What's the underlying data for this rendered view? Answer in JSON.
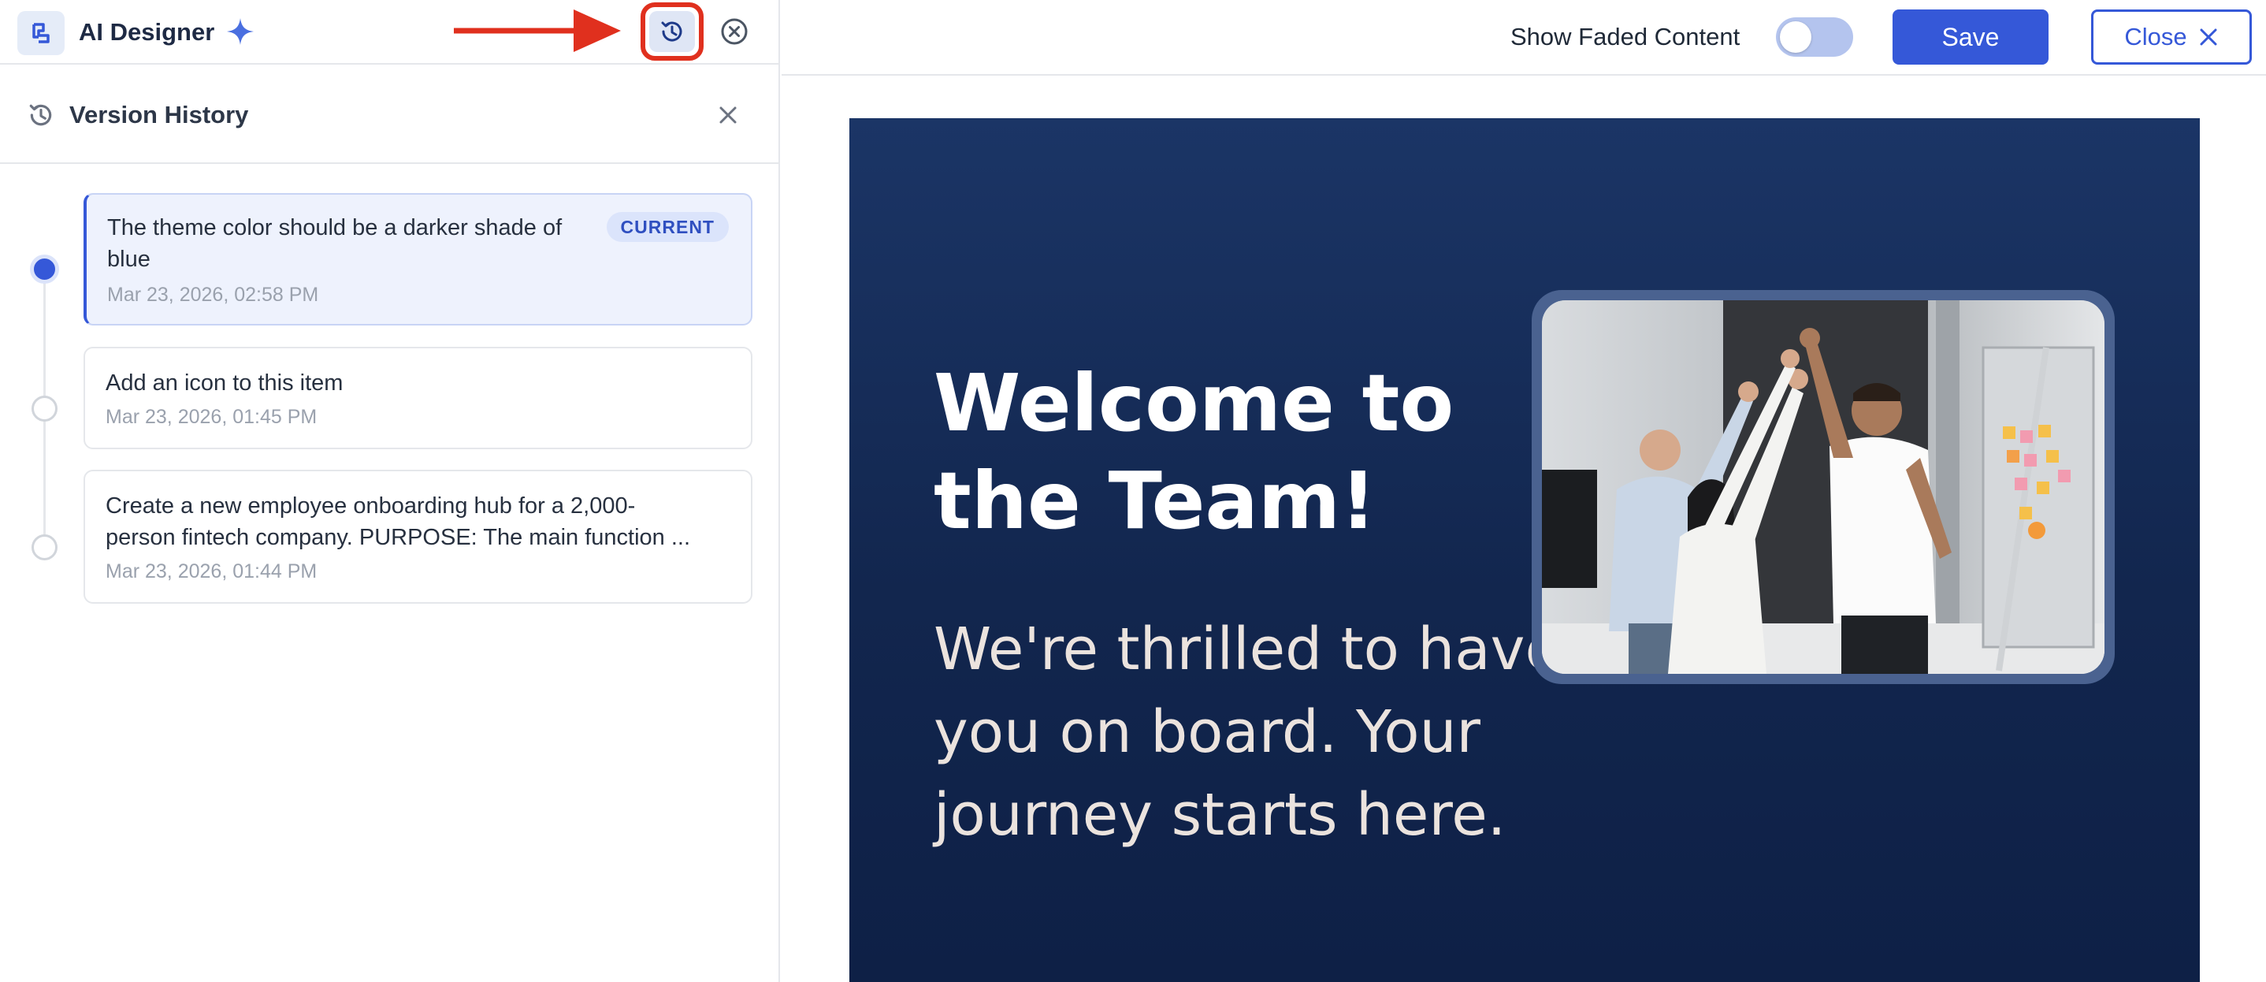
{
  "header": {
    "app_title": "AI Designer"
  },
  "version_history": {
    "title": "Version History",
    "versions": [
      {
        "text_line1": "The theme color should be a darker shade of",
        "text_line2": "blue",
        "date": "Mar 23, 2026, 02:58 PM",
        "badge": "CURRENT",
        "current": true
      },
      {
        "text_line1": "Add an icon to this item",
        "date": "Mar 23, 2026, 01:45 PM",
        "current": false
      },
      {
        "text_line1": "Create a new employee onboarding hub for a 2,000-",
        "text_line2": "person fintech company. PURPOSE: The main function ...",
        "date": "Mar 23, 2026, 01:44 PM",
        "current": false
      }
    ]
  },
  "toolbar": {
    "faded_label": "Show Faded Content",
    "faded_toggle_on": false,
    "save_label": "Save",
    "close_label": "Close"
  },
  "canvas": {
    "headline": "Welcome to the Team!",
    "subtext": "We're thrilled to have you on board. Your journey starts here."
  },
  "icons": {
    "logo": "app-logo-icon",
    "sparkle": "sparkle-icon",
    "history": "history-icon",
    "close_circle": "close-circle-icon",
    "close": "close-icon"
  },
  "colors": {
    "accent": "#3558d8",
    "annotation_red": "#e0301e",
    "canvas_bg": "#17305f"
  }
}
